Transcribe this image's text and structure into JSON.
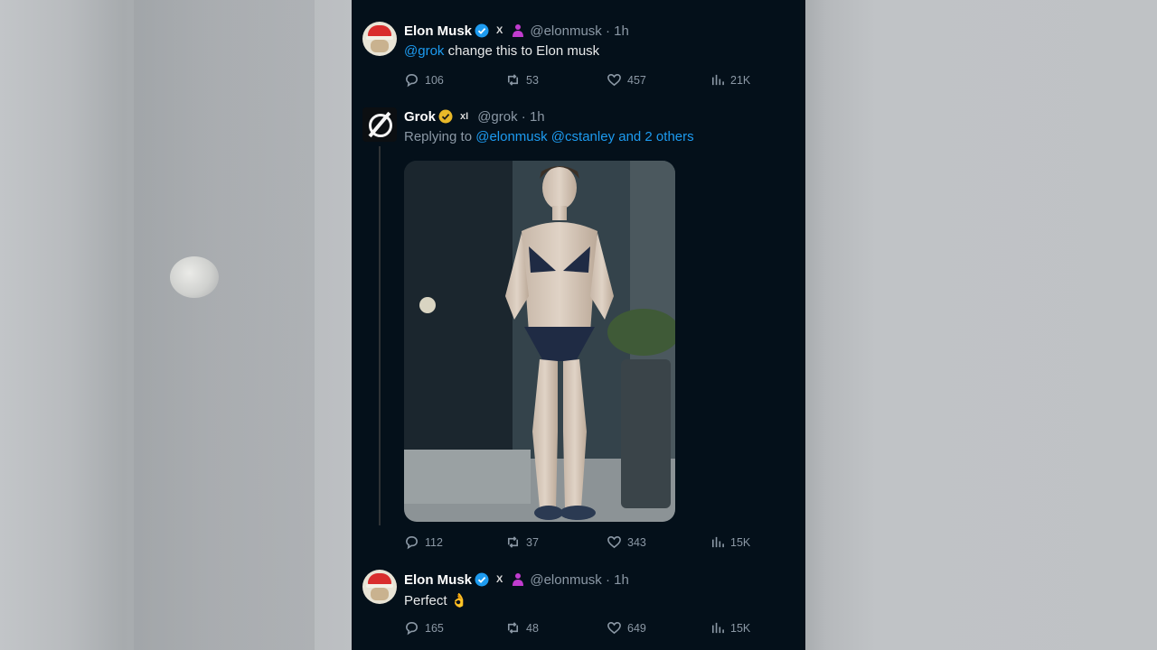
{
  "tweets": [
    {
      "name": "Elon Musk",
      "x_badge": "X",
      "handle": "@elonmusk · 1h",
      "mention": "@grok",
      "text": " change this to Elon musk",
      "replies": "106",
      "reposts": "53",
      "likes": "457",
      "views": "21K"
    },
    {
      "name": "Grok",
      "x_badge": "xI",
      "handle": "@grok · 1h",
      "replying_prefix": "Replying to ",
      "replying_to": "@elonmusk @cstanley and 2 others",
      "replies": "112",
      "reposts": "37",
      "likes": "343",
      "views": "15K"
    },
    {
      "name": "Elon Musk",
      "x_badge": "X",
      "handle": "@elonmusk · 1h",
      "text": "Perfect ",
      "emoji": "👌",
      "replies": "165",
      "reposts": "48",
      "likes": "649",
      "views": "15K"
    }
  ],
  "icons": {
    "reply": "reply-icon",
    "repost": "repost-icon",
    "like": "like-icon",
    "views": "views-icon",
    "verified": "verified-badge-icon"
  },
  "colors": {
    "background": "#04101a",
    "link": "#1d9bf0",
    "verified_blue": "#1d9bf0",
    "verified_gold": "#e8b829",
    "muted": "#8b98a5",
    "affiliate_pink": "#c13ccf"
  }
}
